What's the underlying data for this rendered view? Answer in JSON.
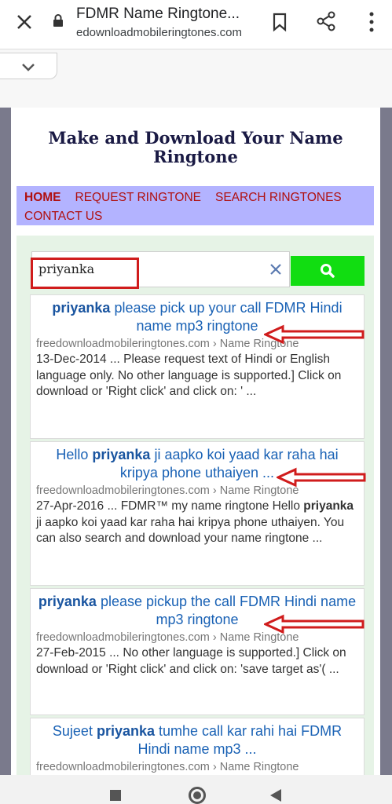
{
  "browser": {
    "title": "FDMR Name Ringtone...",
    "url": "edownloadmobileringtones.com"
  },
  "site": {
    "heading": "Make and Download Your Name Ringtone",
    "nav": [
      "HOME",
      "REQUEST RINGTONE",
      "SEARCH RINGTONES",
      "CONTACT US"
    ]
  },
  "search": {
    "value": "priyanka"
  },
  "results": [
    {
      "title_bold": "priyanka",
      "title_rest": " please pick up your call FDMR Hindi name mp3 ringtone",
      "url": "freedownloadmobileringtones.com › Name Ringtone",
      "snippet_date": "13-Dec-2014",
      "snippet": "Please request text of Hindi or English language only. No other language is supported.] Click on download or 'Right click' and click on: ' ..."
    },
    {
      "title_pre": "Hello ",
      "title_bold": "priyanka",
      "title_rest": " ji aapko koi yaad kar raha hai kripya phone uthaiyen ...",
      "url": "freedownloadmobileringtones.com › Name Ringtone",
      "snippet_date": "27-Apr-2016",
      "snippet_a": "FDMR™ my name ringtone Hello ",
      "snippet_bold": "priyanka",
      "snippet_b": " ji aapko koi yaad kar raha hai kripya phone uthaiyen. You can also search and download your name ringtone ..."
    },
    {
      "title_bold": "priyanka",
      "title_rest": " please pickup the call FDMR Hindi name mp3 ringtone",
      "url": "freedownloadmobileringtones.com › Name Ringtone",
      "snippet_date": "27-Feb-2015",
      "snippet": "No other language is supported.] Click on download or 'Right click' and click on: 'save target as'( ..."
    },
    {
      "title_pre": "Sujeet ",
      "title_bold": "priyanka",
      "title_rest": " tumhe call kar rahi hai FDMR Hindi name mp3 ...",
      "url": "freedownloadmobileringtones.com › Name Ringtone"
    }
  ],
  "colors": {
    "nav_bg": "#b3b3ff",
    "nav_text": "#b01010",
    "search_button": "#11dd11",
    "annotation_red": "#d01c1c"
  },
  "icons": [
    "close-icon",
    "lock-icon",
    "bookmark-icon",
    "share-icon",
    "more-icon",
    "chevron-down-icon",
    "clear-icon",
    "search-icon",
    "recents-icon",
    "home-icon",
    "back-icon"
  ]
}
